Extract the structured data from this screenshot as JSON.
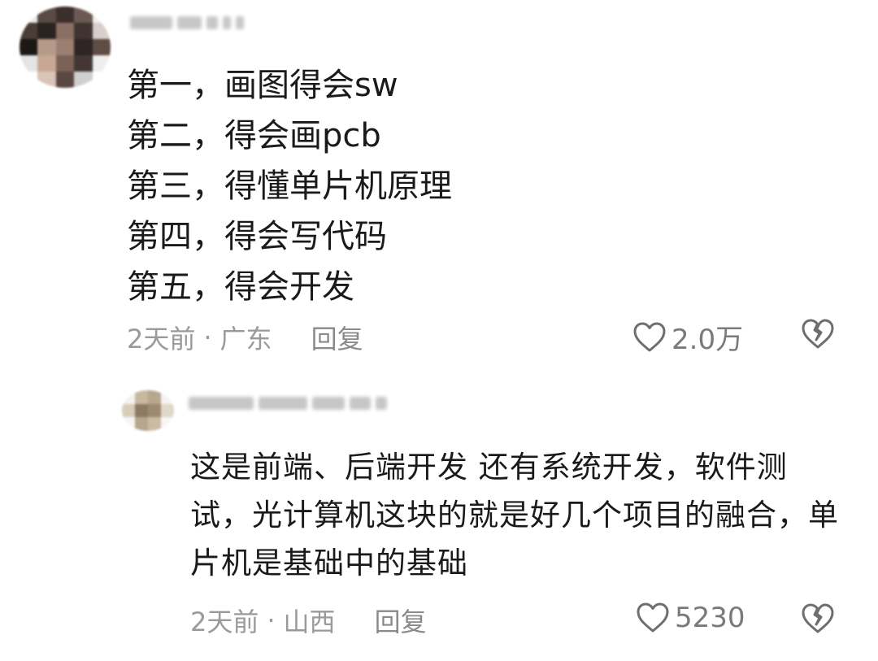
{
  "comment": {
    "lines": [
      "第一，画图得会sw",
      "第二，得会画pcb",
      "第三，得懂单片机原理",
      "第四，得会写代码",
      "第五，得会开发"
    ],
    "time": "2天前",
    "location": "广东",
    "reply_label": "回复",
    "likes": "2.0万",
    "like_icon": "heart-icon",
    "dislike_icon": "broken-heart-icon"
  },
  "reply": {
    "text": "这是前端、后端开发 还有系统开发，软件测试，光计算机这块的就是好几个项目的融合，单片机是基础中的基础",
    "time": "2天前",
    "location": "山西",
    "reply_label": "回复",
    "likes": "5230",
    "like_icon": "heart-icon",
    "dislike_icon": "broken-heart-icon"
  },
  "colors": {
    "text": "#1a1a1a",
    "meta": "#9a9a9a",
    "icon": "#6e6e6e"
  }
}
